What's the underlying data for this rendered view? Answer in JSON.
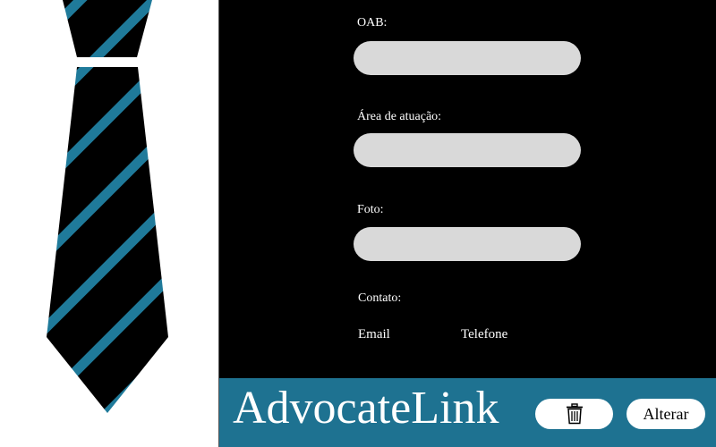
{
  "form": {
    "oab_label": "OAB:",
    "oab_value": "",
    "area_label": "Área de atuação:",
    "area_value": "",
    "foto_label": "Foto:",
    "foto_value": "",
    "contato_label": "Contato:",
    "email_label": "Email",
    "telefone_label": "Telefone"
  },
  "footer": {
    "brand": "AdvocateLink",
    "delete_icon": "trash-icon",
    "alter_label": "Alterar"
  },
  "colors": {
    "accent": "#1e7291",
    "panel_bg": "#000000",
    "input_bg": "#d9d9d9",
    "tie_stripe": "#1f7a9a"
  }
}
